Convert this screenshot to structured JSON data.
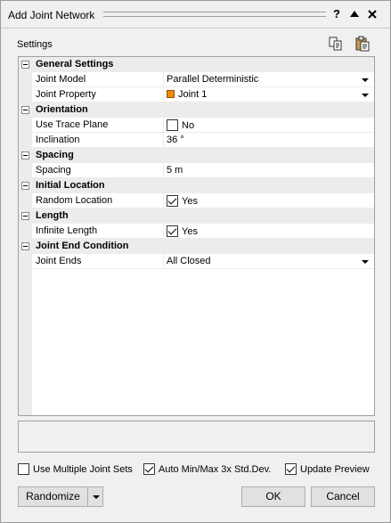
{
  "window": {
    "title": "Add Joint Network",
    "help_label": "?"
  },
  "panel": {
    "settings_label": "Settings",
    "copy_icon": "copy-icon",
    "paste_icon": "paste-icon"
  },
  "grid": {
    "categories": [
      {
        "label": "General Settings"
      },
      {
        "label": "Orientation"
      },
      {
        "label": "Spacing"
      },
      {
        "label": "Initial Location"
      },
      {
        "label": "Length"
      },
      {
        "label": "Joint End Condition"
      }
    ],
    "properties": [
      {
        "name": "Joint Model",
        "value": "Parallel Deterministic"
      },
      {
        "name": "Joint Property",
        "value": "Joint 1"
      },
      {
        "name": "Use Trace Plane",
        "value": "No"
      },
      {
        "name": "Inclination",
        "value": "36 °"
      },
      {
        "name": "Spacing",
        "value": "5 m"
      },
      {
        "name": "Random Location",
        "value": "Yes"
      },
      {
        "name": "Infinite Length",
        "value": "Yes"
      },
      {
        "name": "Joint Ends",
        "value": "All Closed"
      }
    ]
  },
  "colors": {
    "joint_swatch": "#f08c00"
  },
  "options": {
    "multiple_joint_sets": "Use Multiple Joint Sets",
    "auto_minmax": "Auto Min/Max 3x Std.Dev.",
    "update_preview": "Update Preview"
  },
  "buttons": {
    "randomize": "Randomize",
    "ok": "OK",
    "cancel": "Cancel"
  }
}
